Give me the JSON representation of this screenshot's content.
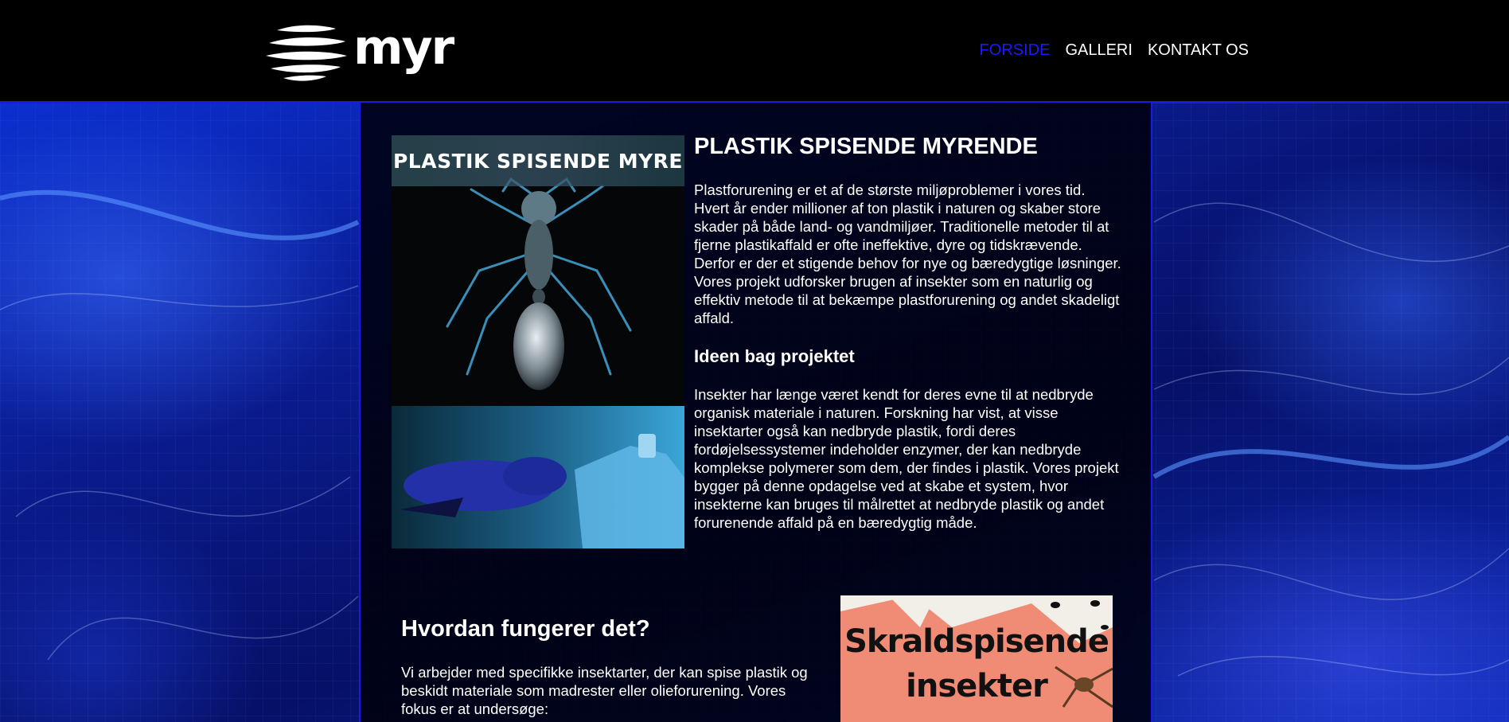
{
  "header": {
    "logo_text": "myr",
    "nav": [
      {
        "label": "FORSIDE",
        "active": true
      },
      {
        "label": "GALLERI",
        "active": false
      },
      {
        "label": "KONTAKT OS",
        "active": false
      }
    ]
  },
  "hero": {
    "image_caption": "PLASTIK SPISENDE MYRE"
  },
  "article": {
    "title": "PLASTIK SPISENDE MYRENDE",
    "intro": "Plastforurening er et af de største miljøproblemer i vores tid. Hvert år ender millioner af ton plastik i naturen og skaber store skader på både land- og vandmiljøer. Traditionelle metoder til at fjerne plastikaffald er ofte ineffektive, dyre og tidskrævende. Derfor er der et stigende behov for nye og bæredygtige løsninger. Vores projekt udforsker brugen af insekter som en naturlig og effektiv metode til at bekæmpe plastforurening og andet skadeligt affald.",
    "subheading": "Ideen bag projektet",
    "body": "Insekter har længe været kendt for deres evne til at nedbryde organisk materiale i naturen. Forskning har vist, at visse insektarter også kan nedbryde plastik, fordi deres fordøjelsessystemer indeholder enzymer, der kan nedbryde komplekse polymerer som dem, der findes i plastik. Vores projekt bygger på denne opdagelse ved at skabe et system, hvor insekterne kan bruges til målrettet at nedbryde plastik og andet forurenende affald på en bæredygtig måde."
  },
  "section2": {
    "heading": "Hvordan fungerer det?",
    "body": "Vi arbejder med specifikke insektarter, der kan spise plastik og beskidt materiale som madrester eller olieforurening. Vores fokus er at undersøge:"
  },
  "promo": {
    "line1": "Skraldspisende",
    "line2": "insekter"
  },
  "colors": {
    "nav_active": "#1a1aff",
    "accent_border": "#1a1ae0",
    "header_bg": "#000000"
  }
}
